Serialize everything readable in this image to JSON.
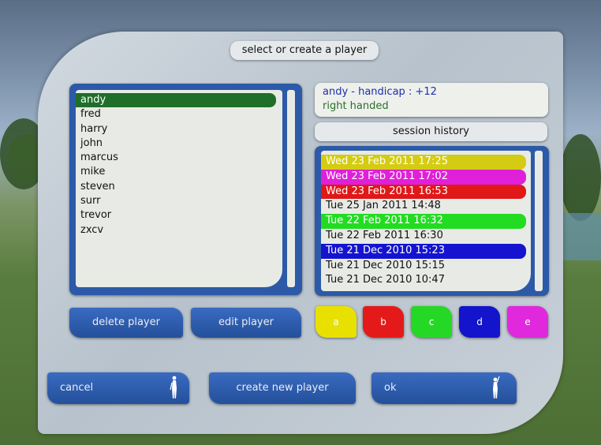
{
  "dialog": {
    "title": "select or create a player"
  },
  "players": [
    "andy",
    "fred",
    "harry",
    "john",
    "marcus",
    "mike",
    "steven",
    "surr",
    "trevor",
    "zxcv"
  ],
  "selected_player_index": 0,
  "player_info": {
    "line1": "andy - handicap : +12",
    "line2": "right handed"
  },
  "session_history": {
    "button_label": "session history",
    "items": [
      {
        "label": "Wed 23 Feb 2011 17:25",
        "color": "#d4cc12",
        "text_color": "#ffffff"
      },
      {
        "label": "Wed 23 Feb 2011 17:02",
        "color": "#e020d8",
        "text_color": "#ffffff"
      },
      {
        "label": "Wed 23 Feb 2011 16:53",
        "color": "#e01818",
        "text_color": "#ffffff"
      },
      {
        "label": "Tue 25 Jan 2011 14:48",
        "color": "",
        "text_color": "#111111"
      },
      {
        "label": "Tue 22 Feb 2011 16:32",
        "color": "#22dc22",
        "text_color": "#ffffff"
      },
      {
        "label": "Tue 22 Feb 2011 16:30",
        "color": "",
        "text_color": "#111111"
      },
      {
        "label": "Tue 21 Dec 2010 15:23",
        "color": "#1414d0",
        "text_color": "#ffffff"
      },
      {
        "label": "Tue 21 Dec 2010 15:15",
        "color": "",
        "text_color": "#111111"
      },
      {
        "label": "Tue 21 Dec 2010 10:47",
        "color": "",
        "text_color": "#111111"
      }
    ]
  },
  "buttons": {
    "delete": "delete player",
    "edit": "edit player",
    "cancel": "cancel",
    "create": "create new player",
    "ok": "ok"
  },
  "color_tags": [
    {
      "label": "a",
      "color": "#e8e000"
    },
    {
      "label": "b",
      "color": "#e41a1a"
    },
    {
      "label": "c",
      "color": "#26d826"
    },
    {
      "label": "d",
      "color": "#1414cc"
    },
    {
      "label": "e",
      "color": "#e028dc"
    }
  ],
  "icons": {
    "golfer": "golfer-silhouette-icon"
  }
}
